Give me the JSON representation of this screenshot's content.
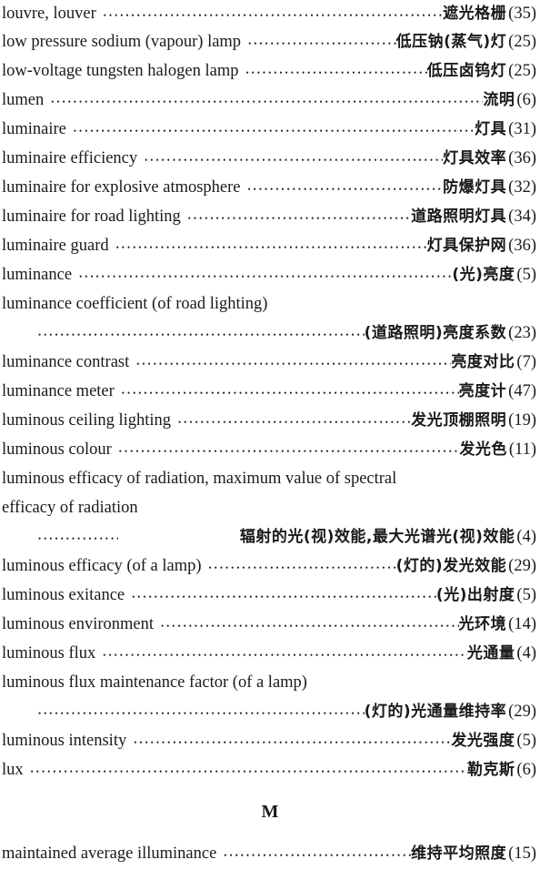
{
  "entries": [
    {
      "en": "louvre, louver",
      "zh": "遮光格栅",
      "page": "(35)"
    },
    {
      "en": "low pressure sodium (vapour) lamp",
      "zh": "低压钠(蒸气)灯",
      "page": "(25)"
    },
    {
      "en": "low-voltage tungsten halogen lamp",
      "zh": "低压卤钨灯",
      "page": "(25)"
    },
    {
      "en": "lumen",
      "zh": "流明",
      "page": "(6)"
    },
    {
      "en": "luminaire",
      "zh": "灯具",
      "page": "(31)"
    },
    {
      "en": "luminaire efficiency",
      "zh": "灯具效率",
      "page": "(36)"
    },
    {
      "en": "luminaire for explosive atmosphere",
      "zh": "防爆灯具",
      "page": "(32)"
    },
    {
      "en": "luminaire for road lighting",
      "zh": "道路照明灯具",
      "page": "(34)"
    },
    {
      "en": "luminaire guard",
      "zh": "灯具保护网",
      "page": "(36)"
    },
    {
      "en": "luminance",
      "zh": "(光)亮度",
      "page": "(5)"
    },
    {
      "en": "luminance coefficient (of road lighting)",
      "zh": "(道路照明)亮度系数",
      "page": "(23)"
    },
    {
      "en": "luminance contrast",
      "zh": "亮度对比",
      "page": "(7)"
    },
    {
      "en": "luminance meter",
      "zh": "亮度计",
      "page": "(47)"
    },
    {
      "en": "luminous ceiling lighting",
      "zh": "发光顶棚照明",
      "page": "(19)"
    },
    {
      "en": "luminous colour",
      "zh": "发光色",
      "page": "(11)"
    },
    {
      "en_line1": "luminous efficacy of radiation, maximum value of spectral",
      "en_line2": "efficacy of radiation",
      "zh": "辐射的光(视)效能,最大光谱光(视)效能",
      "page": "(4)"
    },
    {
      "en": "luminous efficacy (of a lamp)",
      "zh": "(灯的)发光效能",
      "page": "(29)"
    },
    {
      "en": "luminous exitance",
      "zh": "(光)出射度",
      "page": "(5)"
    },
    {
      "en": "luminous environment",
      "zh": "光环境",
      "page": "(14)"
    },
    {
      "en": "luminous flux",
      "zh": "光通量",
      "page": "(4)"
    },
    {
      "en": "luminous flux maintenance factor (of a lamp)",
      "zh": "(灯的)光通量维持率",
      "page": "(29)"
    },
    {
      "en": "luminous intensity",
      "zh": "发光强度",
      "page": "(5)"
    },
    {
      "en": "lux",
      "zh": "勒克斯",
      "page": "(6)"
    }
  ],
  "section_heading": "M",
  "m_entries": [
    {
      "en": "maintained average illuminance",
      "zh": "维持平均照度",
      "page": "(15)"
    }
  ]
}
